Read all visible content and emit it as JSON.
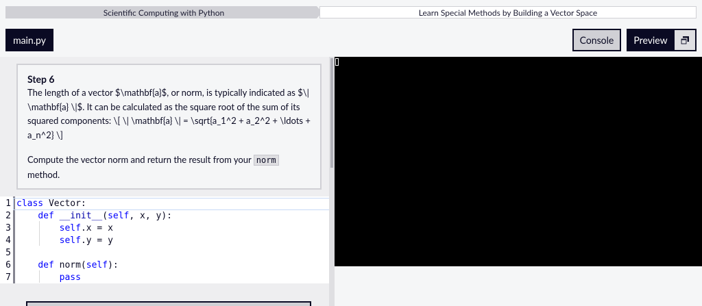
{
  "breadcrumb": {
    "course": "Scientific Computing with Python",
    "project": "Learn Special Methods by Building a Vector Space"
  },
  "toolbar": {
    "file_tab": "main.py",
    "console_label": "Console",
    "preview_label": "Preview",
    "preview_icon": "window-stack-icon"
  },
  "step": {
    "title": "Step 6",
    "paragraph1": "The length of a vector $\\mathbf{a}$, or norm, is typically indicated as $\\| \\mathbf{a} \\|$. It can be calculated as the square root of the sum of its squared components: \\[ \\| \\mathbf{a} \\| = \\sqrt{a_1^2 + a_2^2 + \\ldots + a_n^2} \\]",
    "paragraph2_before": "Compute the vector norm and return the result from your ",
    "paragraph2_code": "norm",
    "paragraph2_after": " method."
  },
  "editor": {
    "lines": [
      {
        "num": "1",
        "text": "class Vector:"
      },
      {
        "num": "2",
        "text": "    def __init__(self, x, y):"
      },
      {
        "num": "3",
        "text": "        self.x = x"
      },
      {
        "num": "4",
        "text": "        self.y = y"
      },
      {
        "num": "5",
        "text": ""
      },
      {
        "num": "6",
        "text": "    def norm(self):"
      },
      {
        "num": "7",
        "text": "        pass"
      }
    ]
  },
  "colors": {
    "dark": "#0a0a23",
    "console_bg": "#000000",
    "keyword": "#0000ff"
  }
}
